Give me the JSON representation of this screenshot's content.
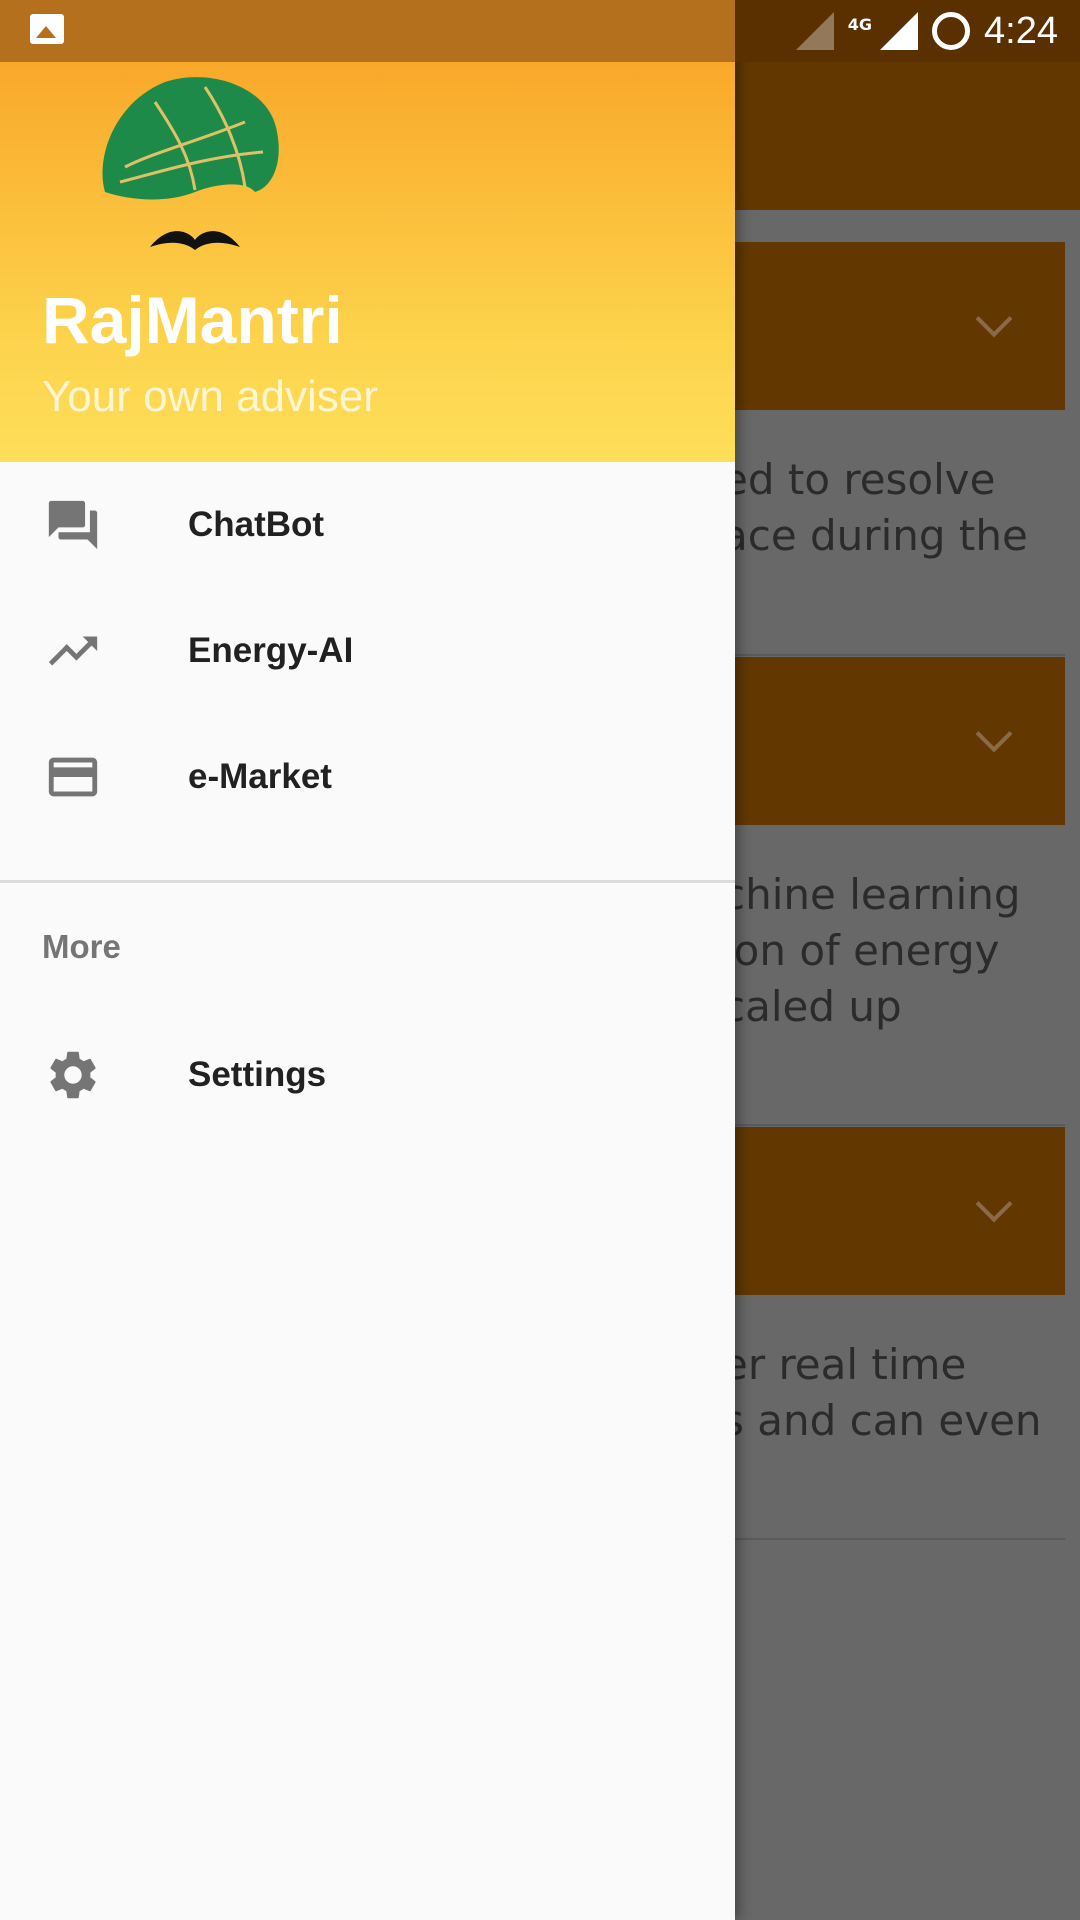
{
  "status_bar": {
    "time": "4:24",
    "network": "4G",
    "icons": [
      "image-icon",
      "signal-empty-icon",
      "signal-full-icon",
      "battery-ring-icon"
    ]
  },
  "drawer": {
    "header": {
      "title": "RajMantri",
      "subtitle": "Your own adviser",
      "logo_icon": "turban-mustache-logo",
      "gradient_colors": [
        "#f9a82a",
        "#fede5a"
      ]
    },
    "items": [
      {
        "label": "ChatBot",
        "icon": "forum-icon"
      },
      {
        "label": "Energy-AI",
        "icon": "trending-up-icon"
      },
      {
        "label": "e-Market",
        "icon": "credit-card-icon"
      }
    ],
    "section_title": "More",
    "more_items": [
      {
        "label": "Settings",
        "icon": "gear-icon"
      }
    ]
  },
  "background": {
    "accent_color": "#633800",
    "snippets": [
      [
        "ed to resolve",
        "ace during the"
      ],
      [
        "chine learning",
        "ion of energy",
        "caled up"
      ],
      [
        "er real time",
        "s and can even"
      ]
    ]
  }
}
